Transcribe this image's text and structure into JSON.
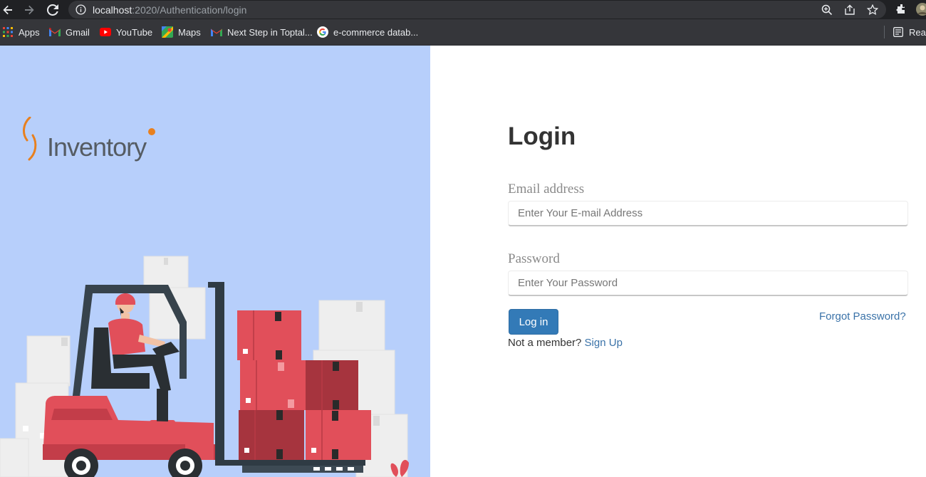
{
  "browser": {
    "url_host": "localhost",
    "url_path": ":2020/Authentication/login",
    "bookmarks": [
      {
        "label": "Apps",
        "icon": "apps-grid-icon"
      },
      {
        "label": "Gmail",
        "icon": "gmail-icon"
      },
      {
        "label": "YouTube",
        "icon": "youtube-icon"
      },
      {
        "label": "Maps",
        "icon": "maps-icon"
      },
      {
        "label": "Next Step in Toptal...",
        "icon": "gmail-icon"
      },
      {
        "label": "e-commerce datab...",
        "icon": "google-icon"
      }
    ],
    "reading_list_label": "Reac"
  },
  "brand": {
    "logo_text": "Inventory",
    "accent_color": "#e8801e"
  },
  "login": {
    "title": "Login",
    "email_label": "Email address",
    "email_placeholder": "Enter Your E-mail Address",
    "email_value": "",
    "password_label": "Password",
    "password_placeholder": "Enter Your Password",
    "password_value": "",
    "submit_label": "Log in",
    "forgot_label": "Forgot Password?",
    "member_prompt": "Not a member?",
    "signup_label": "Sign Up"
  },
  "colors": {
    "left_panel_bg": "#b7cffb",
    "primary_button": "#337ab7",
    "link": "#3a72a8"
  }
}
